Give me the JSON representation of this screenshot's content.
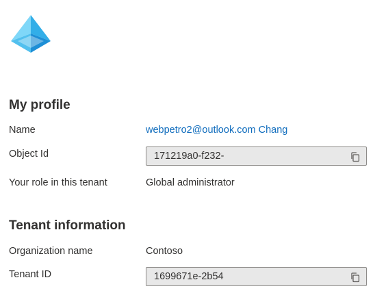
{
  "logo": {
    "icon": "azure-ad-pyramid-logo",
    "colors": {
      "light": "#7fd7f8",
      "mid": "#40b4ec",
      "dark": "#1e90d7"
    }
  },
  "profile": {
    "title": "My profile",
    "name_label": "Name",
    "name_value": "webpetro2@outlook.com Chang",
    "object_id_label": "Object Id",
    "object_id_value": "171219a0-f232-",
    "role_label": "Your role in this tenant",
    "role_value": "Global administrator"
  },
  "tenant": {
    "title": "Tenant information",
    "org_label": "Organization name",
    "org_value": "Contoso",
    "tenant_id_label": "Tenant ID",
    "tenant_id_value": "1699671e-2b54"
  },
  "icons": {
    "copy": "copy-icon"
  },
  "colors": {
    "link": "#0f6cbd",
    "text": "#323130",
    "field_bg": "#e8e8e8",
    "field_border": "#8a8886"
  }
}
